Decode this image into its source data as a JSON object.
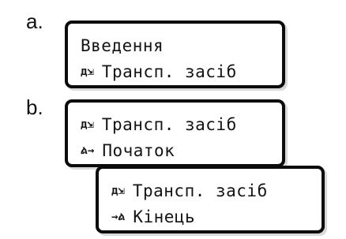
{
  "labels": {
    "a": "a.",
    "b": "b."
  },
  "display_a": {
    "line1": {
      "text": "Введення"
    },
    "line2": {
      "icon": "vehicle-mode-icon",
      "glyph": "д⇲",
      "text": "Трансп. засіб"
    }
  },
  "display_b1": {
    "line1": {
      "icon": "vehicle-mode-icon",
      "glyph": "д⇲",
      "text": "Трансп. засіб"
    },
    "line2": {
      "icon": "location-start-icon",
      "glyph": "ል→",
      "text": "Початок"
    }
  },
  "display_b2": {
    "line1": {
      "icon": "vehicle-mode-icon",
      "glyph": "д⇲",
      "text": "Трансп. засіб"
    },
    "line2": {
      "icon": "location-end-icon",
      "glyph": "→ል",
      "text": "Кінець"
    }
  },
  "colors": {
    "border": "#0b0b0b",
    "text": "#141414",
    "background": "#ffffff"
  }
}
